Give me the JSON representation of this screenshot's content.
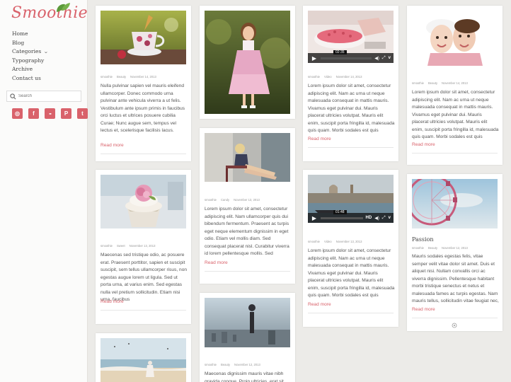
{
  "brand": {
    "name": "Smoothie"
  },
  "nav": [
    {
      "label": "Home"
    },
    {
      "label": "Blog"
    },
    {
      "label": "Categories"
    },
    {
      "label": "Typography"
    },
    {
      "label": "Archive"
    },
    {
      "label": "Contact us"
    }
  ],
  "search": {
    "placeholder": "Search"
  },
  "social": [
    {
      "icon": "dribbble-icon",
      "glyph": "◎"
    },
    {
      "icon": "facebook-icon",
      "glyph": "f"
    },
    {
      "icon": "flickr-icon",
      "glyph": "●●"
    },
    {
      "icon": "pinterest-icon",
      "glyph": "P"
    },
    {
      "icon": "twitter-icon",
      "glyph": "t"
    }
  ],
  "colors": {
    "accent": "#d9626b",
    "background": "#ecebe8"
  },
  "posts": [
    {
      "meta": {
        "author": "smoothie",
        "category": "Beauty",
        "date": "November 14, 2013"
      },
      "excerpt": "Nulla pulvinar sapien vel mauris eleifend ullamcorper. Donec commodo urna pulvinar ante vehicula viverra a ut felis. Vestibulum ante ipsum primis in faucibus orci luctus et ultrices posuere cubilia Curae; Nunc augue sem, tempus vel lectus et, scelerisque facilisis lacus.",
      "more": "Read more"
    },
    {
      "meta": {
        "author": "smoothie",
        "category": "Sweet",
        "date": "November 13, 2013"
      },
      "excerpt": "Maecenas sed tristique odio, ac posuere erat. Praesent porttitor, sapien et suscipit suscipit, sem tellus ullamcorper risus, non egestas augue lorem ut ligula. Sed ut porta urna, at varius enim. Sed egestas nulla vel pretium sollicitudin. Etiam nisi urna, faucibus",
      "more": "Read more"
    },
    {
      "meta": {
        "author": "",
        "category": "",
        "date": ""
      },
      "excerpt": "",
      "more": ""
    },
    {
      "meta": {
        "author": "",
        "category": "",
        "date": ""
      },
      "excerpt": "",
      "more": ""
    },
    {
      "meta": {
        "author": "smoothie",
        "category": "Candy",
        "date": "November 13, 2013"
      },
      "excerpt": "Lorem ipsum dolor sit amet, consectetur adipiscing elit. Nam ullamcorper quis dui bibendum fermentum. Praesent ac turpis eget neque elementum dignissim in eget odio. Etiam vel mollis diam. Sed consequat placerat nisl. Curabitur viverra id lorem pellentesque mollis. Sed",
      "more": "Read more"
    },
    {
      "meta": {
        "author": "smoothie",
        "category": "Beauty",
        "date": "November 12, 2013"
      },
      "excerpt": "Maecenas dignissim mauris vitae nibh gravida congue. Proin ultricies, erat sit amet",
      "more": ""
    },
    {
      "meta": {
        "author": "smoothie",
        "category": "Video",
        "date": "November 14, 2013"
      },
      "excerpt": "Lorem ipsum dolor sit amet, consectetur adipiscing elit. Nam ac urna ut neque malesuada consequat in mattis mauris. Vivamus eget pulvinar dui. Mauris placerat ultricies volutpat. Mauris elit enim, suscipit porta fringilla id, malesuada quis quam. Morbi sodales est quis",
      "more": "Read more",
      "video_time": "02:35"
    },
    {
      "meta": {
        "author": "smoothie",
        "category": "Video",
        "date": "November 13, 2013"
      },
      "excerpt": "Lorem ipsum dolor sit amet, consectetur adipiscing elit. Nam ac urna ut neque malesuada consequat in mattis mauris. Vivamus eget pulvinar dui. Mauris placerat ultricies volutpat. Mauris elit enim, suscipit porta fringilla id, malesuada quis quam. Morbi sodales est quis",
      "more": "Read more",
      "video_time": "01:48"
    },
    {
      "meta": {
        "author": "smoothie",
        "category": "Beauty",
        "date": "November 14, 2013"
      },
      "excerpt": "Lorem ipsum dolor sit amet, consectetur adipiscing elit. Nam ac urna ut neque malesuada consequat in mattis mauris. Vivamus eget pulvinar dui. Mauris placerat ultricies volutpat. Mauris elit enim, suscipit porta fringilla id, malesuada quis quam. Morbi sodales est quis",
      "more": "Read more"
    },
    {
      "title": "Passion",
      "meta": {
        "author": "smoothie",
        "category": "Beauty",
        "date": "November 12, 2013"
      },
      "excerpt": "Mauris sodales egestas felis, vitae semper velit vitae dolor sit amet. Duis et aliquet nisi. Nullam convallis orci ac viverra dignissim. Pellentesque habitant morbi tristique senectus et netus et malesuada fames ac turpis egestas. Nam mauris tellus, sollicitudin vitae feugiat nec,",
      "more": "Read more"
    }
  ]
}
